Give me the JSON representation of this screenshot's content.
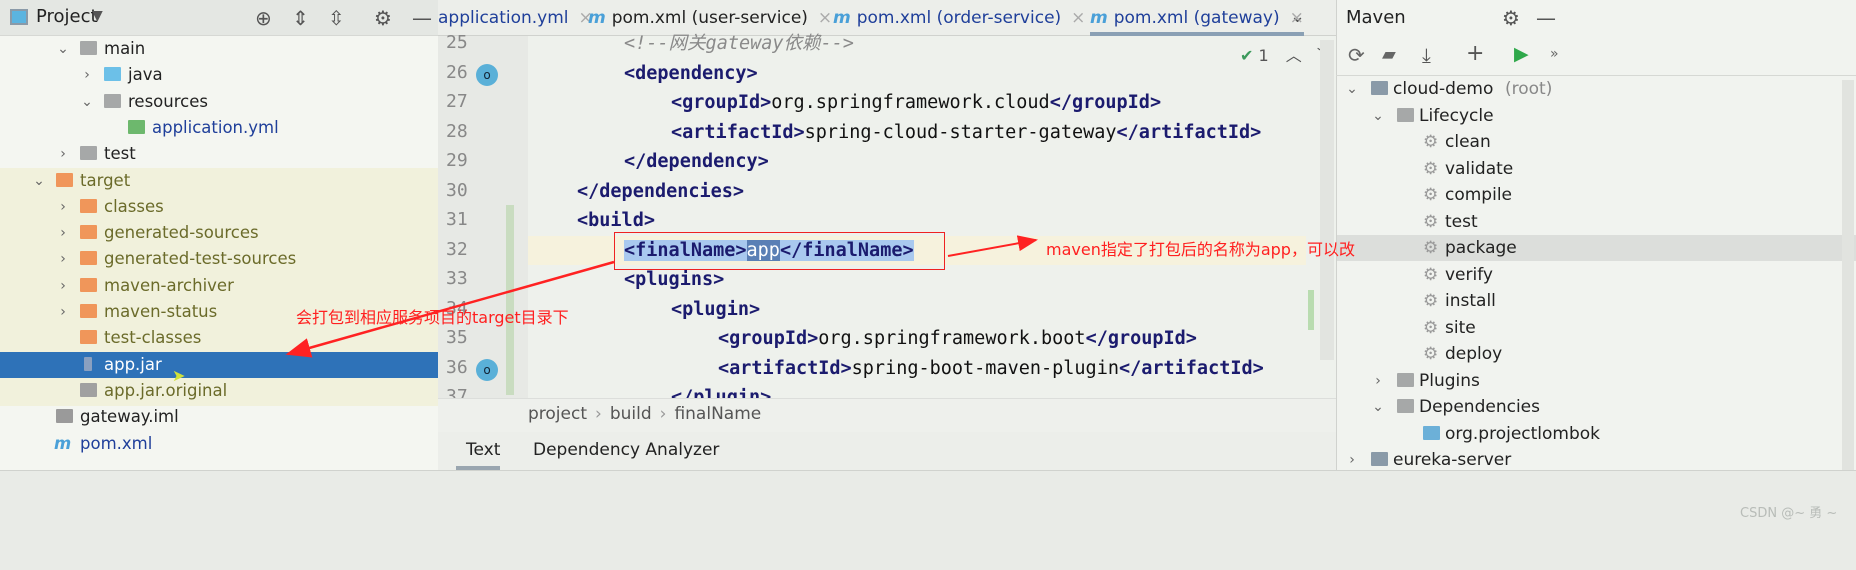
{
  "project_panel": {
    "title": "Project",
    "tree": [
      {
        "label": "main",
        "indent": 3,
        "expanded": true,
        "icon": "folder-gray"
      },
      {
        "label": "java",
        "indent": 4,
        "expanded": false,
        "icon": "folder-blue"
      },
      {
        "label": "resources",
        "indent": 4,
        "expanded": true,
        "icon": "folder-resources"
      },
      {
        "label": "application.yml",
        "indent": 5,
        "icon": "spring-yml",
        "color": "#1f3f9a"
      },
      {
        "label": "test",
        "indent": 3,
        "expanded": false,
        "icon": "folder-gray"
      },
      {
        "label": "target",
        "indent": 2,
        "expanded": true,
        "icon": "folder-orange",
        "color": "#6b6b2a"
      },
      {
        "label": "classes",
        "indent": 3,
        "expanded": false,
        "icon": "folder-orange",
        "color": "#6b6b2a"
      },
      {
        "label": "generated-sources",
        "indent": 3,
        "expanded": false,
        "icon": "folder-orange",
        "color": "#6b6b2a"
      },
      {
        "label": "generated-test-sources",
        "indent": 3,
        "expanded": false,
        "icon": "folder-orange",
        "color": "#6b6b2a"
      },
      {
        "label": "maven-archiver",
        "indent": 3,
        "expanded": false,
        "icon": "folder-orange",
        "color": "#6b6b2a"
      },
      {
        "label": "maven-status",
        "indent": 3,
        "expanded": false,
        "icon": "folder-orange",
        "color": "#6b6b2a"
      },
      {
        "label": "test-classes",
        "indent": 3,
        "icon": "folder-orange",
        "color": "#6b6b2a"
      },
      {
        "label": "app.jar",
        "indent": 3,
        "icon": "jar",
        "selected": true
      },
      {
        "label": "app.jar.original",
        "indent": 3,
        "icon": "unknown-file",
        "color": "#6b6b2a"
      },
      {
        "label": "gateway.iml",
        "indent": 2,
        "icon": "iml-file"
      },
      {
        "label": "pom.xml",
        "indent": 2,
        "icon": "maven-m",
        "color": "#1f3f9a"
      }
    ]
  },
  "editor": {
    "tabs": [
      {
        "label": "application.yml",
        "maven": false,
        "color": "#1f3f9a"
      },
      {
        "label": "pom.xml (user-service)",
        "maven": true
      },
      {
        "label": "pom.xml (order-service)",
        "maven": true,
        "color": "#1f3f9a"
      },
      {
        "label": "pom.xml (gateway)",
        "maven": true,
        "active": true,
        "color": "#1f3f9a"
      }
    ],
    "inspection_count": "1",
    "lines": [
      {
        "n": "25",
        "indent": 2,
        "segs": [
          {
            "t": "<!--网关gateway依赖-->",
            "k": "cm"
          }
        ]
      },
      {
        "n": "26",
        "indent": 2,
        "segs": [
          {
            "t": "<dependency>",
            "k": "tag"
          }
        ]
      },
      {
        "n": "27",
        "indent": 3,
        "segs": [
          {
            "t": "<groupId>",
            "k": "tag"
          },
          {
            "t": "org.springframework.cloud",
            "k": "txt"
          },
          {
            "t": "</groupId>",
            "k": "tag"
          }
        ]
      },
      {
        "n": "28",
        "indent": 3,
        "segs": [
          {
            "t": "<artifactId>",
            "k": "tag"
          },
          {
            "t": "spring-cloud-starter-gateway",
            "k": "txt"
          },
          {
            "t": "</artifactId>",
            "k": "tag"
          }
        ]
      },
      {
        "n": "29",
        "indent": 2,
        "segs": [
          {
            "t": "</dependency>",
            "k": "tag"
          }
        ]
      },
      {
        "n": "30",
        "indent": 1,
        "segs": [
          {
            "t": "</dependencies>",
            "k": "tag"
          }
        ]
      },
      {
        "n": "31",
        "indent": 1,
        "segs": [
          {
            "t": "<build>",
            "k": "tag"
          }
        ]
      },
      {
        "n": "32",
        "indent": 2,
        "segs": [
          {
            "t": "<finalName>",
            "k": "tag hl"
          },
          {
            "t": "app",
            "k": "txt hl2"
          },
          {
            "t": "</finalName>",
            "k": "tag hl"
          }
        ]
      },
      {
        "n": "33",
        "indent": 2,
        "segs": [
          {
            "t": "<plugins>",
            "k": "tag"
          }
        ]
      },
      {
        "n": "34",
        "indent": 3,
        "segs": [
          {
            "t": "<plugin>",
            "k": "tag"
          }
        ]
      },
      {
        "n": "35",
        "indent": 4,
        "segs": [
          {
            "t": "<groupId>",
            "k": "tag"
          },
          {
            "t": "org.springframework.boot",
            "k": "txt"
          },
          {
            "t": "</groupId>",
            "k": "tag"
          }
        ]
      },
      {
        "n": "36",
        "indent": 4,
        "segs": [
          {
            "t": "<artifactId>",
            "k": "tag"
          },
          {
            "t": "spring-boot-maven-plugin",
            "k": "txt"
          },
          {
            "t": "</artifactId>",
            "k": "tag"
          }
        ]
      },
      {
        "n": "37",
        "indent": 3,
        "segs": [
          {
            "t": "</plugin>",
            "k": "tag"
          }
        ]
      }
    ],
    "breadcrumb": [
      "project",
      "build",
      "finalName"
    ],
    "bottom_tabs": [
      "Text",
      "Dependency Analyzer"
    ]
  },
  "annotations": {
    "final_name_note": "maven指定了打包后的名称为app，可以改",
    "target_note": "会打包到相应服务项目的target目录下",
    "color": "#ff2020"
  },
  "maven_panel": {
    "title": "Maven",
    "tree": [
      {
        "label": "cloud-demo",
        "suffix": " (root)",
        "indent": 0,
        "expanded": true,
        "icon": "maven-module"
      },
      {
        "label": "Lifecycle",
        "indent": 1,
        "expanded": true,
        "icon": "folder-gear"
      },
      {
        "label": "clean",
        "indent": 2,
        "icon": "gear"
      },
      {
        "label": "validate",
        "indent": 2,
        "icon": "gear"
      },
      {
        "label": "compile",
        "indent": 2,
        "icon": "gear"
      },
      {
        "label": "test",
        "indent": 2,
        "icon": "gear"
      },
      {
        "label": "package",
        "indent": 2,
        "icon": "gear",
        "hover": true
      },
      {
        "label": "verify",
        "indent": 2,
        "icon": "gear"
      },
      {
        "label": "install",
        "indent": 2,
        "icon": "gear"
      },
      {
        "label": "site",
        "indent": 2,
        "icon": "gear"
      },
      {
        "label": "deploy",
        "indent": 2,
        "icon": "gear"
      },
      {
        "label": "Plugins",
        "indent": 1,
        "expanded": false,
        "icon": "folder-gear"
      },
      {
        "label": "Dependencies",
        "indent": 1,
        "expanded": true,
        "icon": "folder-bars"
      },
      {
        "label": "org.projectlombok",
        "indent": 2,
        "icon": "bars"
      },
      {
        "label": "eureka-server",
        "indent": 0,
        "expanded": false,
        "icon": "maven-module"
      }
    ]
  },
  "watermark": "CSDN @~ 勇 ~"
}
